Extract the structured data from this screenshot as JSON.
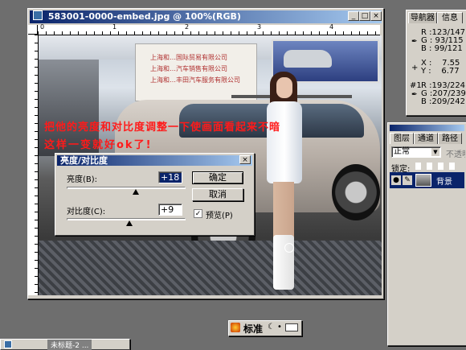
{
  "document_window": {
    "title": "583001-0000-embed.jpg @ 100%(RGB)",
    "min_glyph": "_",
    "max_glyph": "□",
    "close_glyph": "×"
  },
  "overlay_text": {
    "line1": "把他的亮度和对比度调整一下使画面看起来不暗",
    "line2": "这样一变就好ok了!"
  },
  "photo_signs": {
    "sign1": "上海和…国际贸易有限公司",
    "sign2": "上海和…汽车销售有限公司",
    "sign3": "上海和…丰田汽车服务有限公司"
  },
  "dialog": {
    "title": "亮度/对比度",
    "close_glyph": "×",
    "brightness_label": "亮度(B):",
    "brightness_value": "+18",
    "contrast_label": "对比度(C):",
    "contrast_value": "+9",
    "ok_label": "确定",
    "cancel_label": "取消",
    "preview_label": "预览(P)",
    "preview_checked": "✓"
  },
  "info_panel": {
    "tabs": [
      "导航器",
      "信息"
    ],
    "r": "R :123/147",
    "g": "G : 93/115",
    "b": "B : 99/121",
    "x": "X :    7.55",
    "y": "Y :    6.77",
    "sample_label": "#1",
    "r2": "R :193/224",
    "g2": "G :207/239",
    "b2": "B :209/242"
  },
  "layers_panel": {
    "tabs": [
      "图层",
      "通道",
      "路径"
    ],
    "blend_mode": "正常",
    "opacity_label": "不透明",
    "lock_label": "锁定:",
    "layer_name": "背景"
  },
  "status_widget": {
    "label": "标准"
  },
  "taskbar": {
    "item_label": "未标题-2 ..."
  }
}
